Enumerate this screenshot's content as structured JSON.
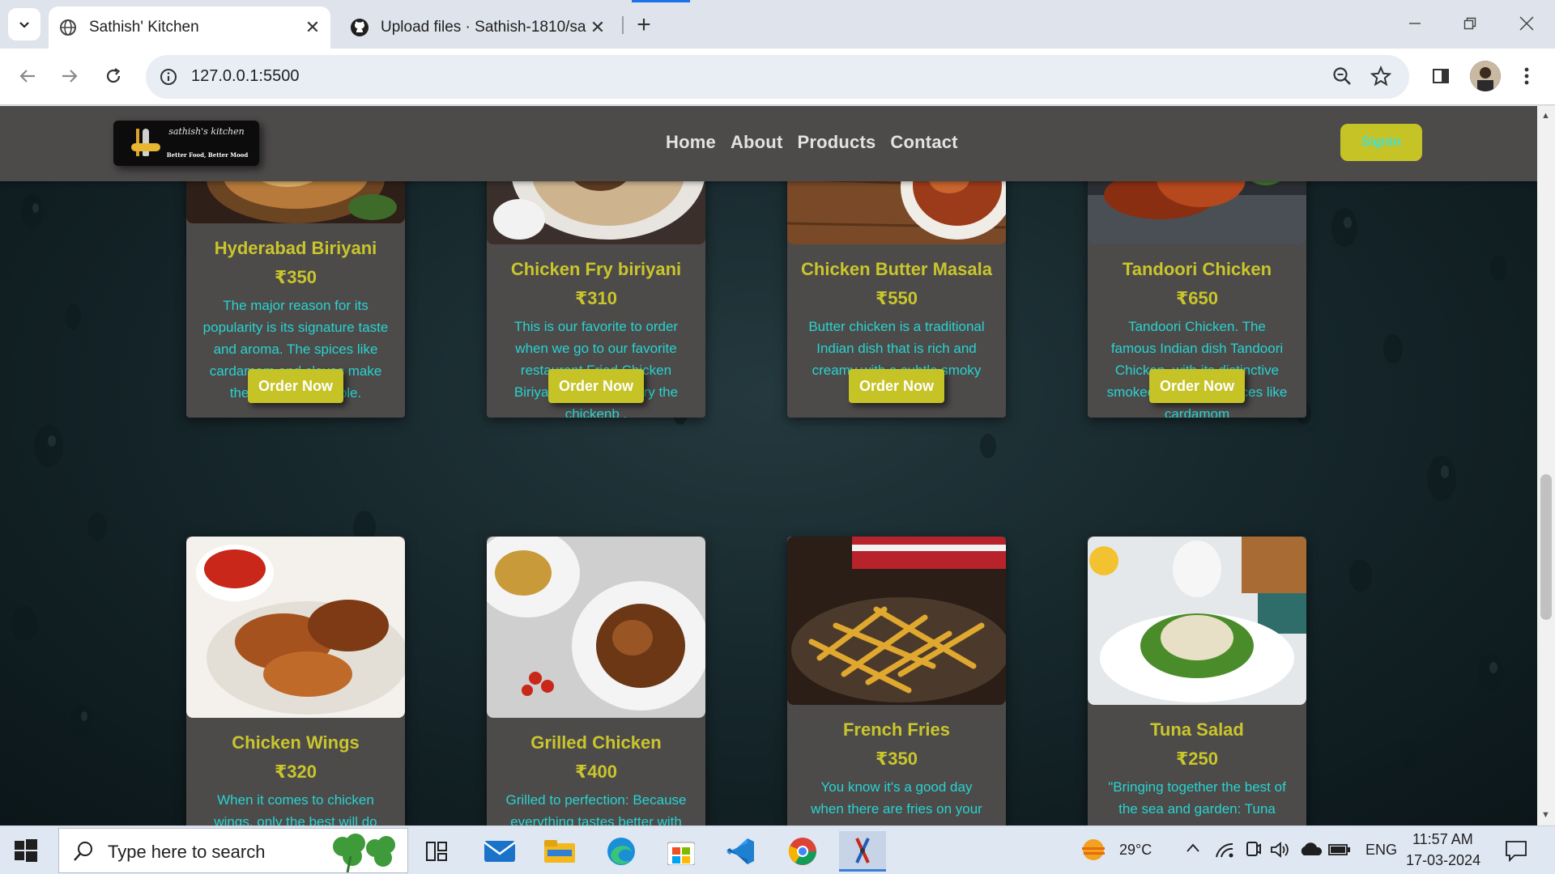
{
  "browser": {
    "tabs": [
      {
        "title": "Sathish' Kitchen",
        "active": true
      },
      {
        "title": "Upload files · Sathish-1810/sath",
        "active": false
      }
    ],
    "url": "127.0.0.1:5500"
  },
  "site": {
    "logo": {
      "name": "sathish's kitchen",
      "tagline": "Better Food, Better Mood"
    },
    "nav": [
      "Home",
      "About",
      "Products",
      "Contact"
    ],
    "signin_label": "Signin"
  },
  "products": [
    {
      "name": "Hyderabad Biriyani",
      "price": "₹350",
      "desc": "The major reason for its popularity is its signature taste and aroma. The spices like cardamom and cloves make the aroma irresistible.",
      "order": "Order Now"
    },
    {
      "name": "Chicken Fry biriyani",
      "price": "₹310",
      "desc": "This is our favorite to order when we go to our favorite restaurant.Fried Chicken Biriyani is where we fry the chickenb .",
      "order": "Order Now"
    },
    {
      "name": "Chicken Butter Masala",
      "price": "₹550",
      "desc": "Butter chicken is a traditional Indian dish that is rich and creamy with a subtle smoky flavor",
      "order": "Order Now"
    },
    {
      "name": "Tandoori Chicken",
      "price": "₹650",
      "desc": "Tandoori Chicken. The famous Indian dish Tandoori Chicken, with its distinctive smoked taste, The spices like cardamom",
      "order": "Order Now"
    },
    {
      "name": "Chicken Wings",
      "price": "₹320",
      "desc": "When it comes to chicken wings, only the best will do"
    },
    {
      "name": "Grilled Chicken",
      "price": "₹400",
      "desc": "Grilled to perfection: Because everything tastes better with"
    },
    {
      "name": "French Fries",
      "price": "₹350",
      "desc": "You know it's a good day when there are fries on your plate!"
    },
    {
      "name": "Tuna Salad",
      "price": "₹250",
      "desc": "\"Bringing together the best of the sea and garden: Tuna salad"
    }
  ],
  "taskbar": {
    "search_placeholder": "Type here to search",
    "weather": "29°C",
    "language": "ENG",
    "time": "11:57 AM",
    "date": "17-03-2024"
  },
  "colors": {
    "header_bg": "#4d4a4a",
    "card_bg": "#4d4a4a",
    "accent_yellow": "#c9c62c",
    "desc_cyan": "#27d4d0"
  }
}
